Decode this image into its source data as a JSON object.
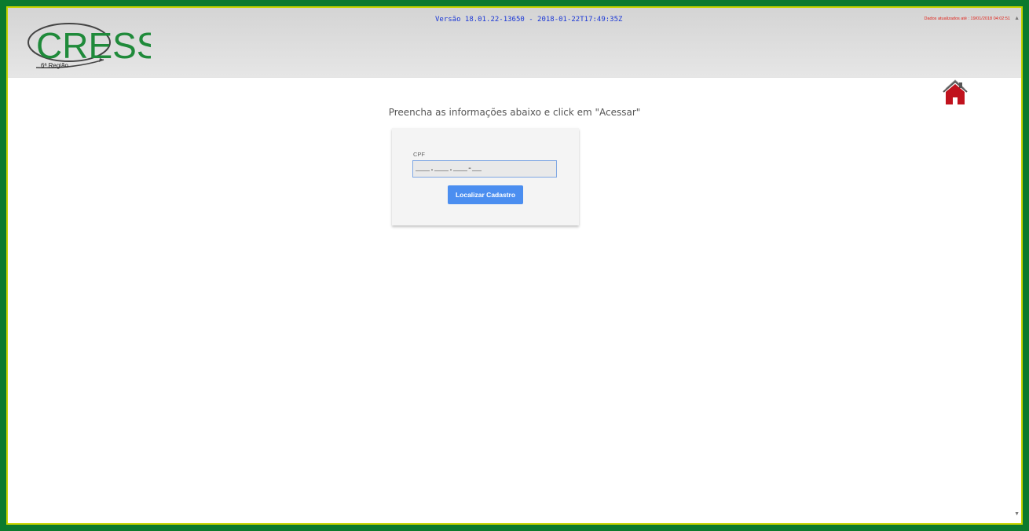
{
  "header": {
    "version": "Versão 18.01.22-13650 - 2018-01-22T17:49:35Z",
    "updated": "Dados atualizados até : 19/01/2018 04:02:51",
    "logo_text": "CRESS",
    "logo_subtext": "6ª Região"
  },
  "main": {
    "instructions": "Preencha as informações abaixo e click em \"Acessar\"",
    "cpf_label": "CPF",
    "cpf_value": "___.___.___-__",
    "submit_label": "Localizar Cadastro"
  },
  "icons": {
    "home": "home-icon"
  },
  "colors": {
    "frame": "#0b7a2e",
    "version_text": "#1a37d6",
    "updated_text": "#e0241b",
    "button": "#4b8ef0",
    "home_icon": "#c0121d"
  }
}
